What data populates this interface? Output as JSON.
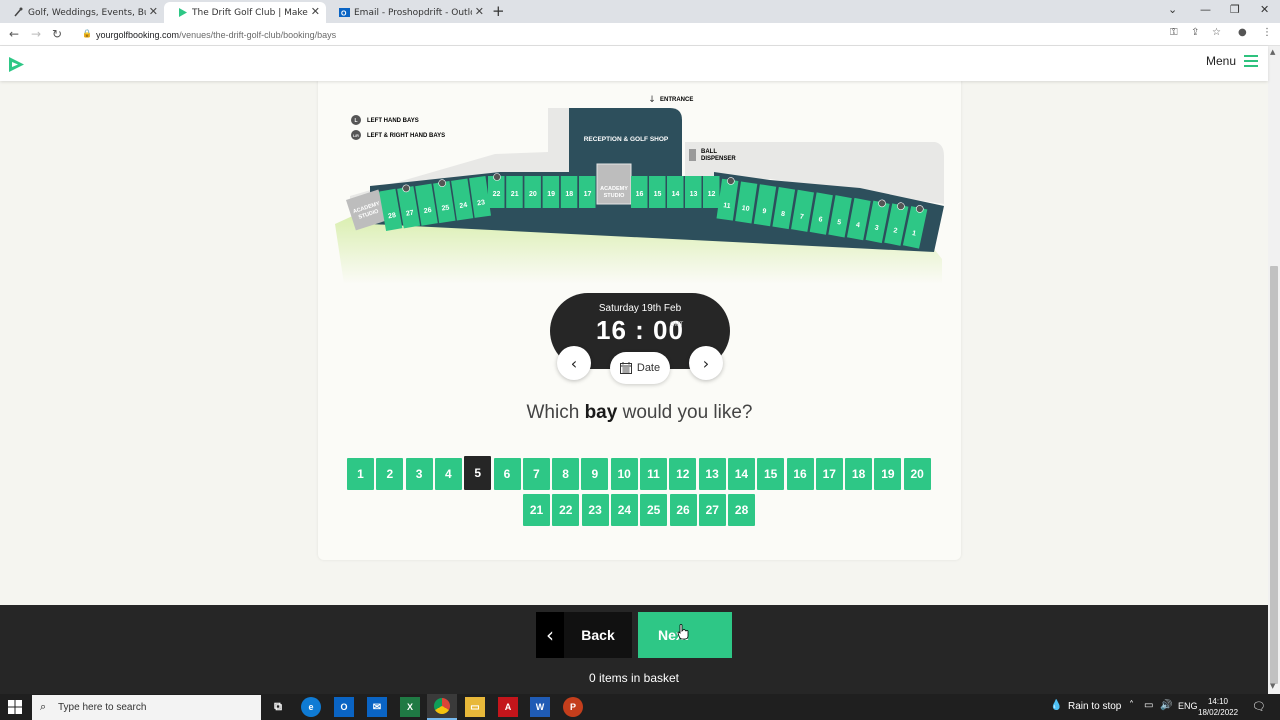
{
  "browser": {
    "tabs": [
      {
        "title": "Golf, Weddings, Events, Business"
      },
      {
        "title": "The Drift Golf Club | Make a booking"
      },
      {
        "title": "Email - Proshopdrift - Outlook"
      }
    ],
    "url_main": "yourgolfbooking.com",
    "url_path": "/venues/the-drift-golf-club/booking/bays"
  },
  "header": {
    "menu_label": "Menu"
  },
  "map": {
    "legend": {
      "left_hand": "LEFT HAND BAYS",
      "left_right_hand": "LEFT & RIGHT HAND BAYS",
      "left_key": "L",
      "lr_key": "L/R"
    },
    "entrance": "ENTRANCE",
    "reception": "RECEPTION & GOLF SHOP",
    "ball_dispenser_line1": "BALL",
    "ball_dispenser_line2": "DISPENSER",
    "academy_studio_line1": "ACADEMY",
    "academy_studio_line2": "STUDIO"
  },
  "booking": {
    "date": "Saturday 19th Feb",
    "time": "16 : 00",
    "timezone": "GMT",
    "date_button": "Date",
    "question_pre": "Which ",
    "question_bold": "bay",
    "question_post": " would you like?",
    "bays": [
      "1",
      "2",
      "3",
      "4",
      "5",
      "6",
      "7",
      "8",
      "9",
      "10",
      "11",
      "12",
      "13",
      "14",
      "15",
      "16",
      "17",
      "18",
      "19",
      "20",
      "21",
      "22",
      "23",
      "24",
      "25",
      "26",
      "27",
      "28"
    ],
    "selected_bay": "5"
  },
  "footer": {
    "back_label": "Back",
    "next_label": "Next",
    "basket_text": "0 items in basket"
  },
  "taskbar": {
    "search_placeholder": "Type here to search",
    "weather": "Rain to stop",
    "lang": "ENG",
    "time": "14:10",
    "date": "18/02/2022"
  },
  "colors": {
    "accent": "#2ec786",
    "dark": "#262626"
  }
}
